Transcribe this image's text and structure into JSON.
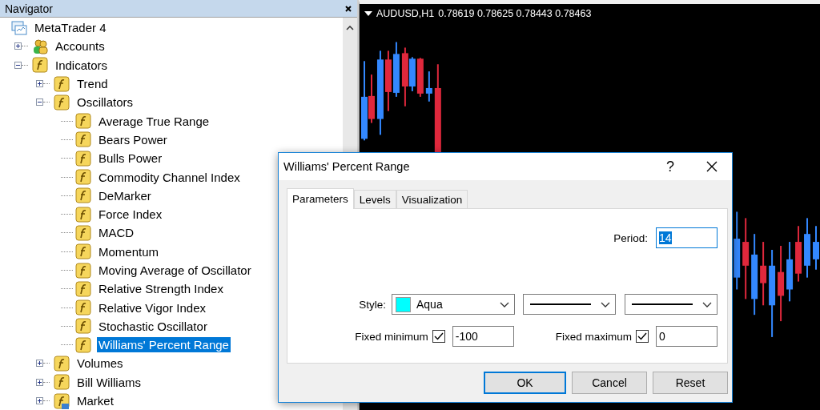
{
  "navigator": {
    "title": "Navigator",
    "tree": [
      {
        "label": "MetaTrader 4",
        "kind": "terminal",
        "selected": false,
        "children": [
          {
            "label": "Accounts",
            "kind": "accounts",
            "selected": false,
            "expanded": false
          },
          {
            "label": "Indicators",
            "kind": "indicator",
            "selected": false,
            "expanded": true,
            "children": [
              {
                "label": "Trend",
                "kind": "indicator",
                "selected": false,
                "expanded": false
              },
              {
                "label": "Oscillators",
                "kind": "indicator",
                "selected": false,
                "expanded": true,
                "children": [
                  {
                    "label": "Average True Range",
                    "kind": "indicator",
                    "selected": false
                  },
                  {
                    "label": "Bears Power",
                    "kind": "indicator",
                    "selected": false
                  },
                  {
                    "label": "Bulls Power",
                    "kind": "indicator",
                    "selected": false
                  },
                  {
                    "label": "Commodity Channel Index",
                    "kind": "indicator",
                    "selected": false
                  },
                  {
                    "label": "DeMarker",
                    "kind": "indicator",
                    "selected": false
                  },
                  {
                    "label": "Force Index",
                    "kind": "indicator",
                    "selected": false
                  },
                  {
                    "label": "MACD",
                    "kind": "indicator",
                    "selected": false
                  },
                  {
                    "label": "Momentum",
                    "kind": "indicator",
                    "selected": false
                  },
                  {
                    "label": "Moving Average of Oscillator",
                    "kind": "indicator",
                    "selected": false
                  },
                  {
                    "label": "Relative Strength Index",
                    "kind": "indicator",
                    "selected": false
                  },
                  {
                    "label": "Relative Vigor Index",
                    "kind": "indicator",
                    "selected": false
                  },
                  {
                    "label": "Stochastic Oscillator",
                    "kind": "indicator",
                    "selected": false
                  },
                  {
                    "label": "Williams' Percent Range",
                    "kind": "indicator",
                    "selected": true
                  }
                ]
              },
              {
                "label": "Volumes",
                "kind": "indicator",
                "selected": false,
                "expanded": false
              },
              {
                "label": "Bill Williams",
                "kind": "indicator",
                "selected": false,
                "expanded": false
              },
              {
                "label": "Market",
                "kind": "market",
                "selected": false,
                "expanded": false
              }
            ]
          }
        ]
      }
    ]
  },
  "chart": {
    "symbol": "AUDUSD,H1",
    "prices": "0.78619 0.78625 0.78443 0.78463"
  },
  "dialog": {
    "title": "Williams' Percent Range",
    "help": "?",
    "tabs": [
      {
        "label": "Parameters",
        "selected": true
      },
      {
        "label": "Levels",
        "selected": false
      },
      {
        "label": "Visualization",
        "selected": false
      }
    ],
    "period": {
      "label": "Period:",
      "value": "14"
    },
    "style": {
      "label": "Style:",
      "color_name": "Aqua",
      "color": "#00ffff"
    },
    "fixed_minimum": {
      "label": "Fixed minimum",
      "checked": true,
      "value": "-100"
    },
    "fixed_maximum": {
      "label": "Fixed maximum",
      "checked": true,
      "value": "0"
    },
    "buttons": [
      {
        "label": "OK",
        "default": true
      },
      {
        "label": "Cancel",
        "default": false
      },
      {
        "label": "Reset",
        "default": false
      }
    ]
  }
}
